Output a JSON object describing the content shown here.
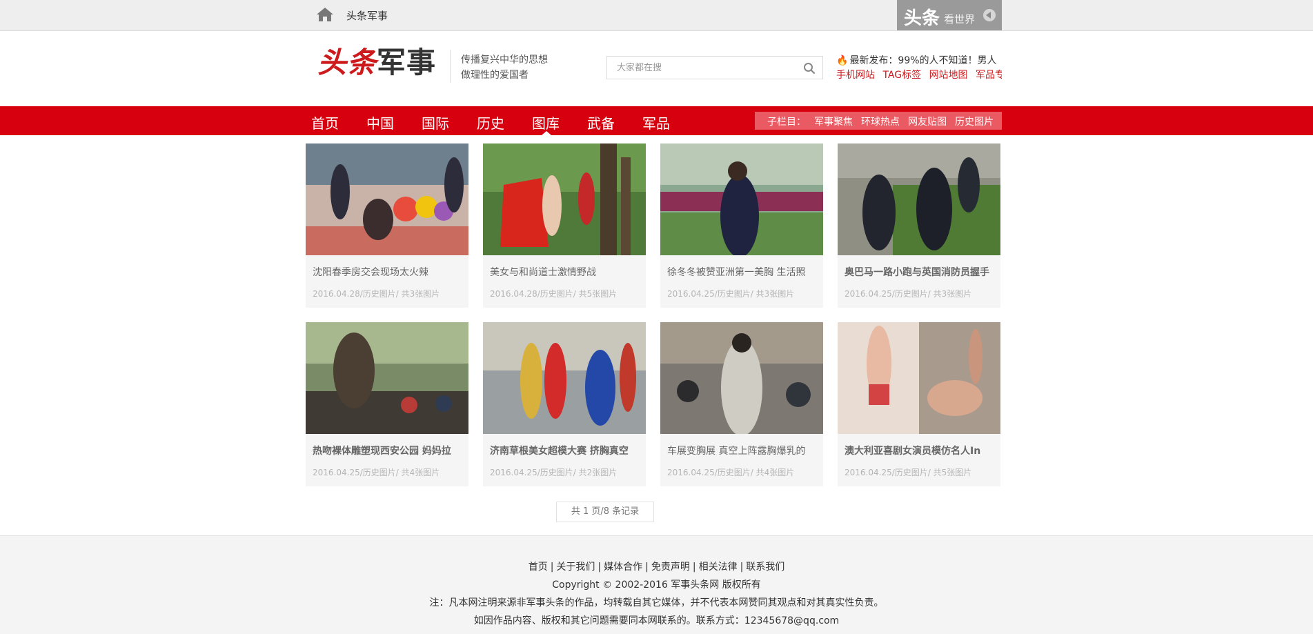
{
  "topbar": {
    "site_name": "头条军事",
    "badge_main": "头条",
    "badge_sub": "看世界"
  },
  "header": {
    "logo_part1": "头条",
    "logo_part2": "军事",
    "slogan_line1": "传播复兴中华的思想",
    "slogan_line2": "做理性的爱国者",
    "search_placeholder": "大家都在搜",
    "latest_news": "最新发布：99%的人不知道！男人",
    "links": [
      "手机网站",
      "TAG标签",
      "网站地图",
      "军品专卖"
    ]
  },
  "nav": {
    "items": [
      "首页",
      "中国",
      "国际",
      "历史",
      "图库",
      "武备",
      "军品"
    ],
    "active_index": 4,
    "sub_label": "子栏目：",
    "sub_items": [
      "军事聚焦",
      "环球热点",
      "网友贴图",
      "历史图片"
    ]
  },
  "gallery": [
    {
      "title": "沈阳春季房交会现场太火辣",
      "meta": "2016.04.28/历史图片/ 共3张图片",
      "bold": false
    },
    {
      "title": "美女与和尚道士激情野战",
      "meta": "2016.04.28/历史图片/ 共5张图片",
      "bold": false
    },
    {
      "title": "徐冬冬被赞亚洲第一美胸 生活照",
      "meta": "2016.04.25/历史图片/ 共3张图片",
      "bold": false
    },
    {
      "title": "奥巴马一路小跑与英国消防员握手",
      "meta": "2016.04.25/历史图片/ 共3张图片",
      "bold": true
    },
    {
      "title": "热吻裸体雕塑现西安公园 妈妈拉",
      "meta": "2016.04.25/历史图片/ 共4张图片",
      "bold": true
    },
    {
      "title": "济南草根美女超模大赛 挤胸真空",
      "meta": "2016.04.25/历史图片/ 共2张图片",
      "bold": true
    },
    {
      "title": "车展变胸展 真空上阵露胸爆乳的",
      "meta": "2016.04.25/历史图片/ 共4张图片",
      "bold": false
    },
    {
      "title": "澳大利亚喜剧女演员模仿名人In",
      "meta": "2016.04.25/历史图片/ 共5张图片",
      "bold": true
    }
  ],
  "pager": {
    "text": "共 1 页/8 条记录"
  },
  "footer": {
    "links": [
      "首页",
      "关于我们",
      "媒体合作",
      "免责声明",
      "相关法律",
      "联系我们"
    ],
    "copyright": "Copyright © 2002-2016 军事头条网 版权所有",
    "disclaimer": "注：凡本网注明来源非军事头条的作品，均转载自其它媒体，并不代表本网赞同其观点和对其真实性负责。",
    "contact": "如因作品内容、版权和其它问题需要同本网联系的。联系方式：12345678@qq.com"
  },
  "colors": {
    "brand_red": "#d6000f",
    "logo_red": "#cc1a1d",
    "sub_nav_bg": "#ea5a62"
  }
}
